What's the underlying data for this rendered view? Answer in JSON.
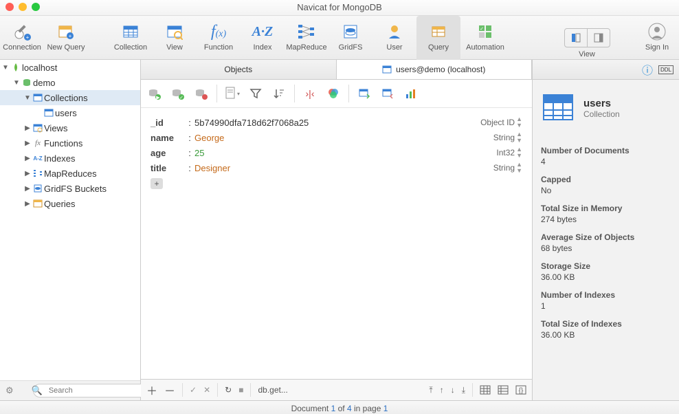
{
  "window": {
    "title": "Navicat for MongoDB"
  },
  "toolbar": {
    "connection": "Connection",
    "newquery": "New Query",
    "collection": "Collection",
    "view": "View",
    "function": "Function",
    "index": "Index",
    "mapreduce": "MapReduce",
    "gridfs": "GridFS",
    "user": "User",
    "query": "Query",
    "automation": "Automation",
    "viewgroup": "View",
    "signin": "Sign In"
  },
  "tree": {
    "root": "localhost",
    "db": "demo",
    "collections": "Collections",
    "users": "users",
    "views": "Views",
    "functions": "Functions",
    "indexes": "Indexes",
    "mapreduces": "MapReduces",
    "gridfs": "GridFS Buckets",
    "queries": "Queries"
  },
  "search": {
    "placeholder": "Search"
  },
  "tabs": {
    "objects": "Objects",
    "doc": "users@demo (localhost)"
  },
  "fields": [
    {
      "key": "_id",
      "value": "5b74990dfa718d62f7068a25",
      "type": "Object ID",
      "cls": ""
    },
    {
      "key": "name",
      "value": "George",
      "type": "String",
      "cls": "orange"
    },
    {
      "key": "age",
      "value": "25",
      "type": "Int32",
      "cls": "green"
    },
    {
      "key": "title",
      "value": "Designer",
      "type": "String",
      "cls": "orange"
    }
  ],
  "footer": {
    "cmd": "db.get..."
  },
  "info": {
    "title": "users",
    "sub": "Collection",
    "stats": [
      {
        "k": "Number of Documents",
        "v": "4"
      },
      {
        "k": "Capped",
        "v": "No"
      },
      {
        "k": "Total Size in Memory",
        "v": "274 bytes"
      },
      {
        "k": "Average Size of Objects",
        "v": "68 bytes"
      },
      {
        "k": "Storage Size",
        "v": "36.00 KB"
      },
      {
        "k": "Number of Indexes",
        "v": "1"
      },
      {
        "k": "Total Size of Indexes",
        "v": "36.00 KB"
      }
    ]
  },
  "status": {
    "prefix": "Document ",
    "n1": "1",
    "mid": " of ",
    "n2": "4",
    "mid2": " in page ",
    "n3": "1"
  }
}
